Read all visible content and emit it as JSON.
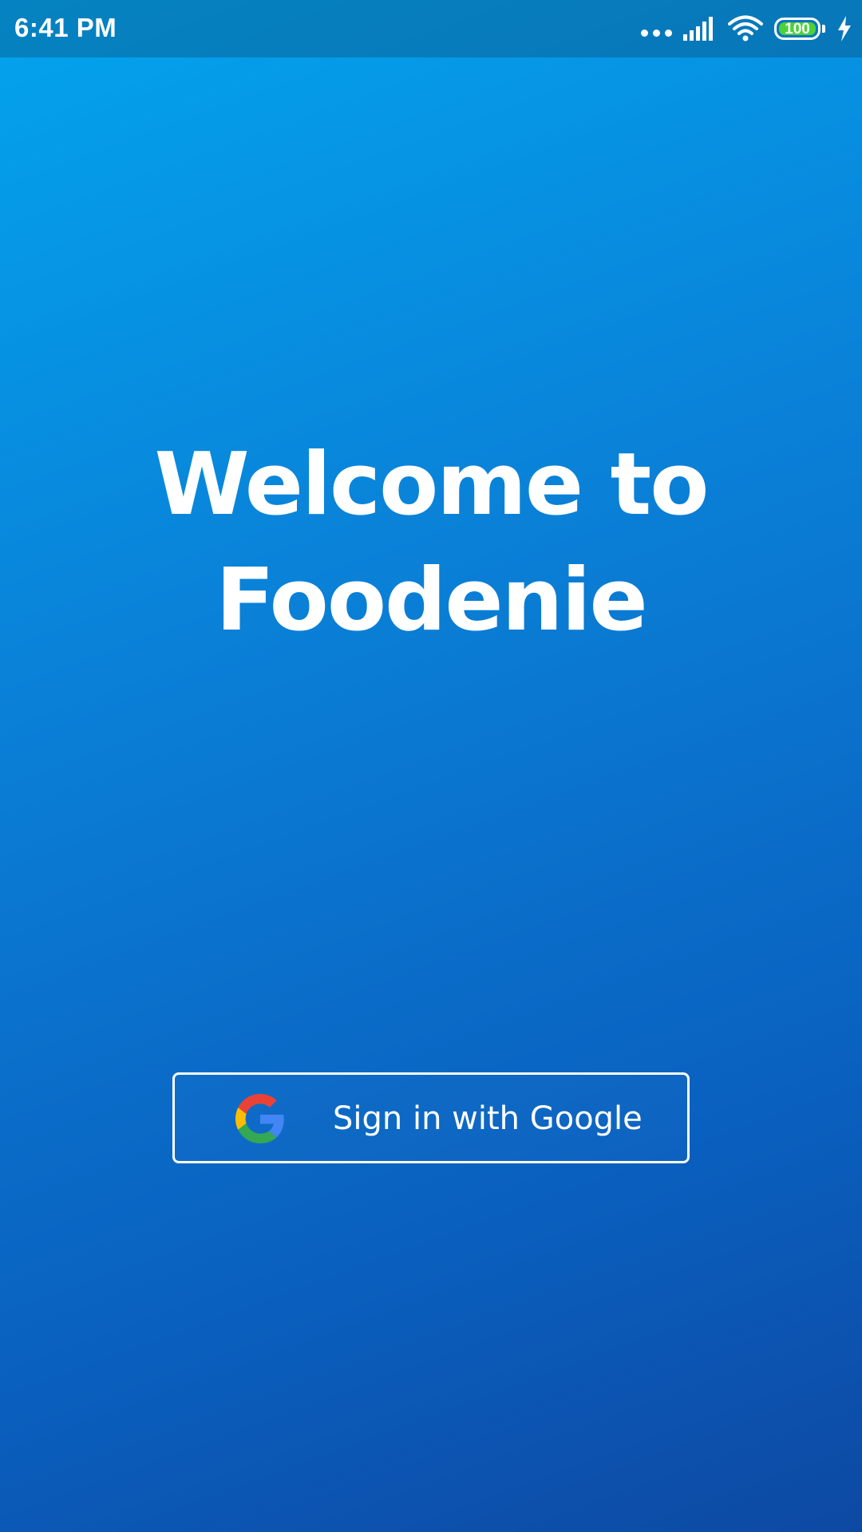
{
  "status_bar": {
    "time": "6:41 PM",
    "battery_level": "100",
    "icons": [
      "more-dots-icon",
      "signal-icon",
      "wifi-icon",
      "battery-icon",
      "charging-icon"
    ],
    "battery_color": "#4cd13b"
  },
  "welcome": {
    "line1": "Welcome to",
    "line2": "Foodenie"
  },
  "signin": {
    "label": "Sign in with Google",
    "icon": "google-icon"
  },
  "colors": {
    "gradient_start": "#03a4ee",
    "gradient_end": "#0d49a3",
    "text": "#ffffff"
  }
}
